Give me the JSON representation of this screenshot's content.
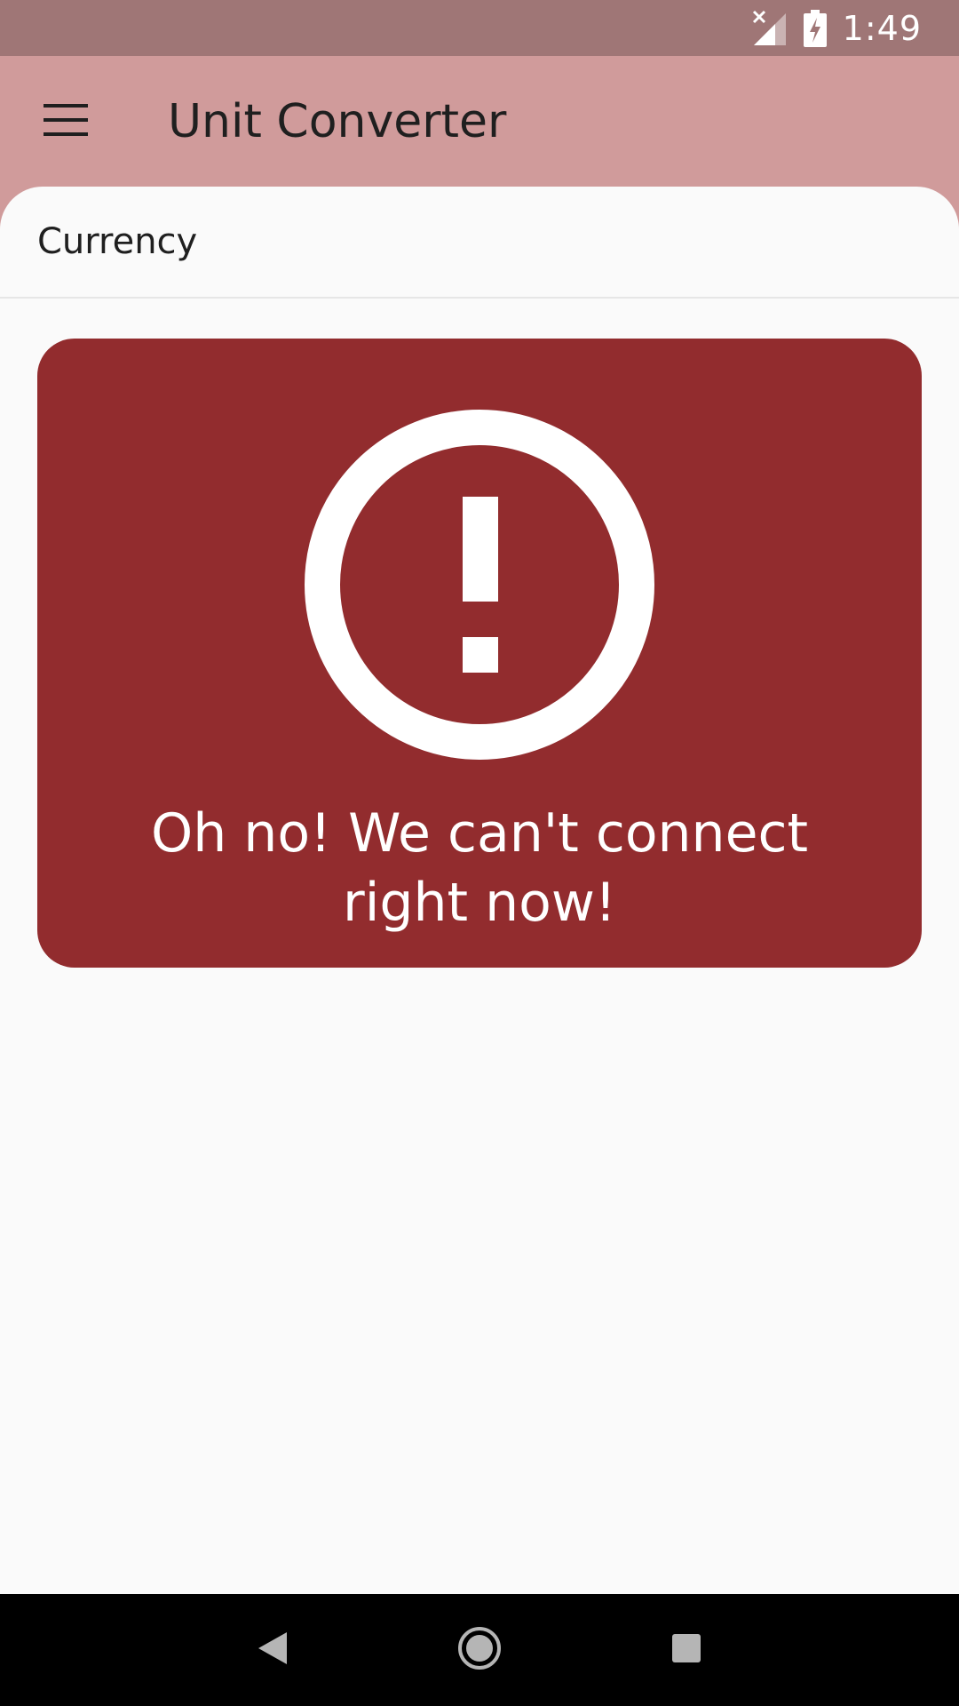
{
  "status_bar": {
    "time": "1:49",
    "icons": [
      "signal-off-icon",
      "battery-charging-icon"
    ]
  },
  "app_bar": {
    "title": "Unit Converter",
    "menu_icon": "hamburger-menu-icon"
  },
  "section": {
    "title": "Currency"
  },
  "error": {
    "icon": "exclamation-circle-icon",
    "message": "Oh no! We can't connect right now!"
  },
  "nav_bar": {
    "buttons": [
      "back-icon",
      "home-icon",
      "recents-icon"
    ]
  },
  "colors": {
    "status_bar": "#9f7676",
    "app_bar": "#d09b9b",
    "error_card": "#922c2e",
    "background": "#fafafa"
  }
}
